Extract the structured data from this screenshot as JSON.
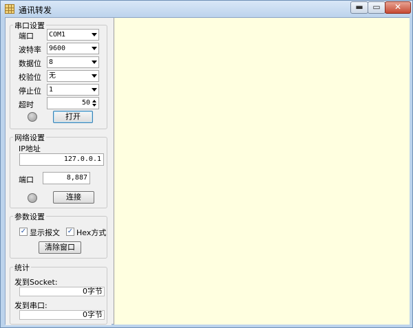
{
  "window": {
    "title": "通讯转发",
    "min": "▬",
    "max": "▭",
    "close": "✕"
  },
  "serial": {
    "group_title": "串口设置",
    "port_label": "端口",
    "port_value": "COM1",
    "baud_label": "波特率",
    "baud_value": "9600",
    "databits_label": "数据位",
    "databits_value": "8",
    "parity_label": "校验位",
    "parity_value": "无",
    "stopbits_label": "停止位",
    "stopbits_value": "1",
    "timeout_label": "超时",
    "timeout_value": "50",
    "open_button": "打开"
  },
  "network": {
    "group_title": "网络设置",
    "ip_label": "IP地址",
    "ip_value": "127.0.0.1",
    "port_label": "端口",
    "port_value": "8,887",
    "connect_button": "连接"
  },
  "params": {
    "group_title": "参数设置",
    "show_message_label": "显示报文",
    "show_message_checked": true,
    "hex_mode_label": "Hex方式",
    "hex_mode_checked": true,
    "clear_button": "清除窗口"
  },
  "stats": {
    "group_title": "统计",
    "to_socket_label": "发到Socket:",
    "to_socket_value": "0字节",
    "to_serial_label": "发到串口:",
    "to_serial_value": "0字节"
  },
  "colors": {
    "output_bg": "#ffffe0",
    "panel_bg": "#f0f0f0",
    "title_bg": "#bcd3ec"
  }
}
